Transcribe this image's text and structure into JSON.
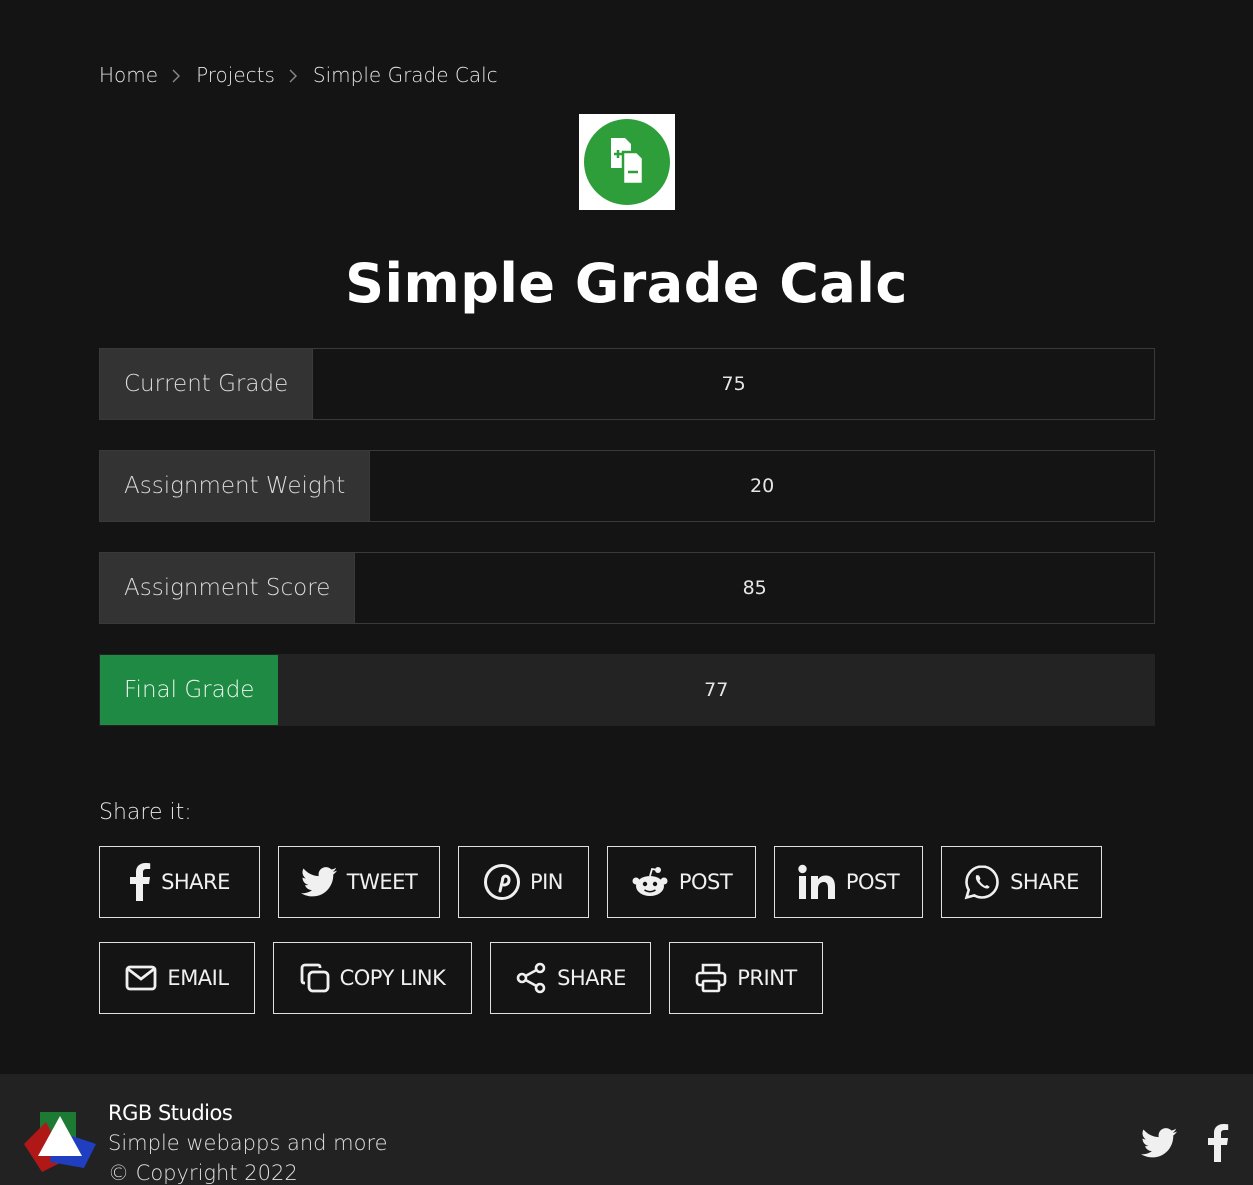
{
  "breadcrumb": {
    "home": "Home",
    "projects": "Projects",
    "current": "Simple Grade Calc"
  },
  "page": {
    "title": "Simple Grade Calc"
  },
  "calculator": {
    "current_grade": {
      "label": "Current Grade",
      "value": "75"
    },
    "assignment_weight": {
      "label": "Assignment Weight",
      "value": "20"
    },
    "assignment_score": {
      "label": "Assignment Score",
      "value": "85"
    },
    "final_grade": {
      "label": "Final Grade",
      "value": "77"
    }
  },
  "share": {
    "heading": "Share it:",
    "facebook": "SHARE",
    "twitter": "TWEET",
    "pinterest": "PIN",
    "reddit": "POST",
    "linkedin": "POST",
    "whatsapp": "SHARE",
    "email": "EMAIL",
    "copy_link": "COPY LINK",
    "share": "SHARE",
    "print": "PRINT"
  },
  "footer": {
    "brand": "RGB Studios",
    "tagline": "Simple webapps and more",
    "copyright": "© Copyright 2022"
  },
  "colors": {
    "background": "#141414",
    "label_bg": "#333333",
    "accent_green": "#1f8a43",
    "logo_green": "#2e9e3a",
    "footer_bg": "#222222"
  }
}
